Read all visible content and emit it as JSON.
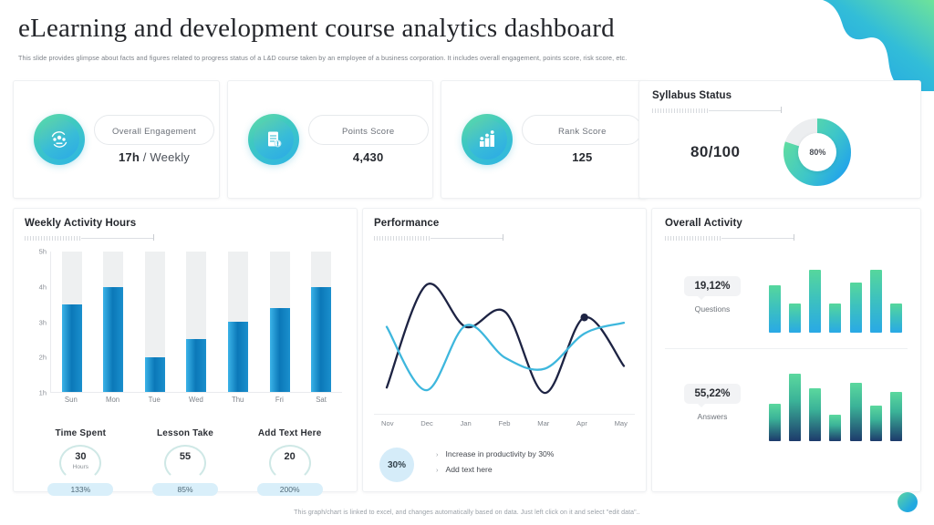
{
  "header": {
    "title": "eLearning and development course analytics dashboard",
    "subtitle": "This slide provides glimpse about facts and figures related to progress status of a L&D course taken by an employee of a business corporation. It includes overall engagement,  points score, risk score, etc."
  },
  "kpis": [
    {
      "icon": "people-engagement-icon",
      "label": "Overall  Engagement",
      "value_strong": "17h",
      "value_rest": " / Weekly"
    },
    {
      "icon": "clipboard-points-icon",
      "label": "Points Score",
      "value_strong": "4,430",
      "value_rest": ""
    },
    {
      "icon": "rank-podium-icon",
      "label": "Rank Score",
      "value_strong": "125",
      "value_rest": ""
    }
  ],
  "syllabus": {
    "title": "Syllabus Status",
    "score": "80/100",
    "donut_label": "80%",
    "donut_percent": 80,
    "colors": {
      "start": "#5ddba3",
      "end": "#24a6e8",
      "track": "#eceef0"
    }
  },
  "weekly": {
    "title": "Weekly Activity Hours",
    "gauges": [
      {
        "title": "Time Spent",
        "number": "30",
        "unit": "Hours",
        "percent": "133%"
      },
      {
        "title": "Lesson Take",
        "number": "55",
        "unit": "",
        "percent": "85%"
      },
      {
        "title": "Add Text Here",
        "number": "20",
        "unit": "",
        "percent": "200%"
      }
    ]
  },
  "performance": {
    "title": "Performance",
    "bubble": "30%",
    "items": [
      "Increase in productivity  by 30%",
      "Add text here"
    ]
  },
  "activity": {
    "title": "Overall Activity",
    "blocks": [
      {
        "value": "19,12%",
        "label": "Questions"
      },
      {
        "value": "55,22%",
        "label": "Answers"
      }
    ]
  },
  "footer": "This graph/chart is linked to excel, and changes automatically based on data. Just left click on it and select \"edit data\"..",
  "chart_data": [
    {
      "type": "bar",
      "title": "Weekly Activity Hours",
      "categories": [
        "Sun",
        "Mon",
        "Tue",
        "Wed",
        "Thu",
        "Fri",
        "Sat"
      ],
      "values": [
        3.5,
        4.0,
        2.0,
        2.5,
        3.0,
        3.4,
        4.0
      ],
      "ylabel": "",
      "xlabel": "",
      "ylim": [
        1,
        5
      ],
      "ytick_labels": [
        "1h",
        "2h",
        "3h",
        "4h",
        "5h"
      ],
      "track_max": 5,
      "grid": false,
      "legend": "none",
      "series_color": "#0b78b8",
      "track_color": "#eef0f1"
    },
    {
      "type": "line",
      "title": "Performance",
      "x": [
        "Nov",
        "Dec",
        "Jan",
        "Feb",
        "Mar",
        "Apr",
        "May"
      ],
      "series": [
        {
          "name": "series-dark",
          "color": "#1d2343",
          "values": [
            10,
            86,
            55,
            66,
            6,
            62,
            26
          ]
        },
        {
          "name": "series-light",
          "color": "#3eb7dd",
          "values": [
            55,
            8,
            56,
            32,
            24,
            50,
            58
          ]
        }
      ],
      "marker": {
        "series": "series-dark",
        "x": "Apr",
        "value": 62
      },
      "ylim": [
        0,
        100
      ],
      "grid": false,
      "legend": "none"
    },
    {
      "type": "pie",
      "subtype": "donut",
      "title": "Syllabus Status",
      "categories": [
        "Completed",
        "Remaining"
      ],
      "values": [
        80,
        20
      ],
      "center_label": "80%"
    },
    {
      "type": "bar",
      "title": "Questions",
      "categories": [
        "1",
        "2",
        "3",
        "4",
        "5",
        "6",
        "7"
      ],
      "values": [
        62,
        38,
        82,
        38,
        66,
        82,
        38
      ],
      "ylim": [
        0,
        100
      ],
      "grid": false,
      "legend": "none"
    },
    {
      "type": "bar",
      "title": "Answers",
      "categories": [
        "1",
        "2",
        "3",
        "4",
        "5",
        "6",
        "7"
      ],
      "values": [
        48,
        88,
        68,
        34,
        76,
        46,
        64
      ],
      "ylim": [
        0,
        100
      ],
      "grid": false,
      "legend": "none"
    }
  ]
}
